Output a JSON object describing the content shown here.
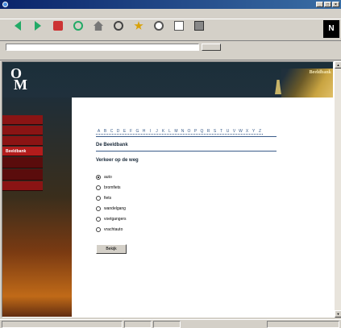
{
  "window": {
    "title": ""
  },
  "menu": {
    "items": [
      "",
      "",
      "",
      "",
      "",
      "",
      ""
    ]
  },
  "toolbar": {
    "buttons": [
      {
        "label": "",
        "icon": "back-icon"
      },
      {
        "label": "",
        "icon": "forward-icon"
      },
      {
        "label": "",
        "icon": "stop-icon"
      },
      {
        "label": "",
        "icon": "refresh-icon"
      },
      {
        "label": "",
        "icon": "home-icon"
      },
      {
        "label": "",
        "icon": "search-icon"
      },
      {
        "label": "",
        "icon": "favorites-icon"
      },
      {
        "label": "",
        "icon": "history-icon"
      },
      {
        "label": "",
        "icon": "mail-icon"
      },
      {
        "label": "",
        "icon": "print-icon"
      }
    ],
    "ie_logo": "N"
  },
  "address": {
    "label": "",
    "value": "",
    "go": ""
  },
  "links": {
    "label": "",
    "items": [
      "",
      "",
      "",
      "",
      "",
      ""
    ]
  },
  "header": {
    "logo_initial_1": "O",
    "logo_initial_2": "M",
    "logo_word_1": "",
    "logo_word_2": "",
    "graphic_label": "Beeldbank"
  },
  "nav": {
    "section": "",
    "items": [
      {
        "label": "",
        "active": false
      },
      {
        "label": "",
        "active": false
      },
      {
        "label": "",
        "active": false
      },
      {
        "label": "Beeldbank",
        "active": true
      },
      {
        "label": "",
        "sub": true
      },
      {
        "label": "",
        "sub": true
      },
      {
        "label": "",
        "active": false
      }
    ]
  },
  "content": {
    "alphabet": [
      "A",
      "B",
      "C",
      "D",
      "E",
      "F",
      "G",
      "H",
      "I",
      "J",
      "K",
      "L",
      "M",
      "N",
      "O",
      "P",
      "Q",
      "R",
      "S",
      "T",
      "U",
      "V",
      "W",
      "X",
      "Y",
      "Z"
    ],
    "title": "De Beeldbank",
    "subtitle": "Verkeer op de weg",
    "options": [
      {
        "label": "auto",
        "checked": true
      },
      {
        "label": "bromfiets",
        "checked": false
      },
      {
        "label": "fiets",
        "checked": false
      },
      {
        "label": "wandelgang",
        "checked": false
      },
      {
        "label": "voetgangers",
        "checked": false
      },
      {
        "label": "vrachtauto",
        "checked": false
      }
    ],
    "submit_label": "Bekijk"
  },
  "status": {
    "text": "",
    "zone": ""
  }
}
